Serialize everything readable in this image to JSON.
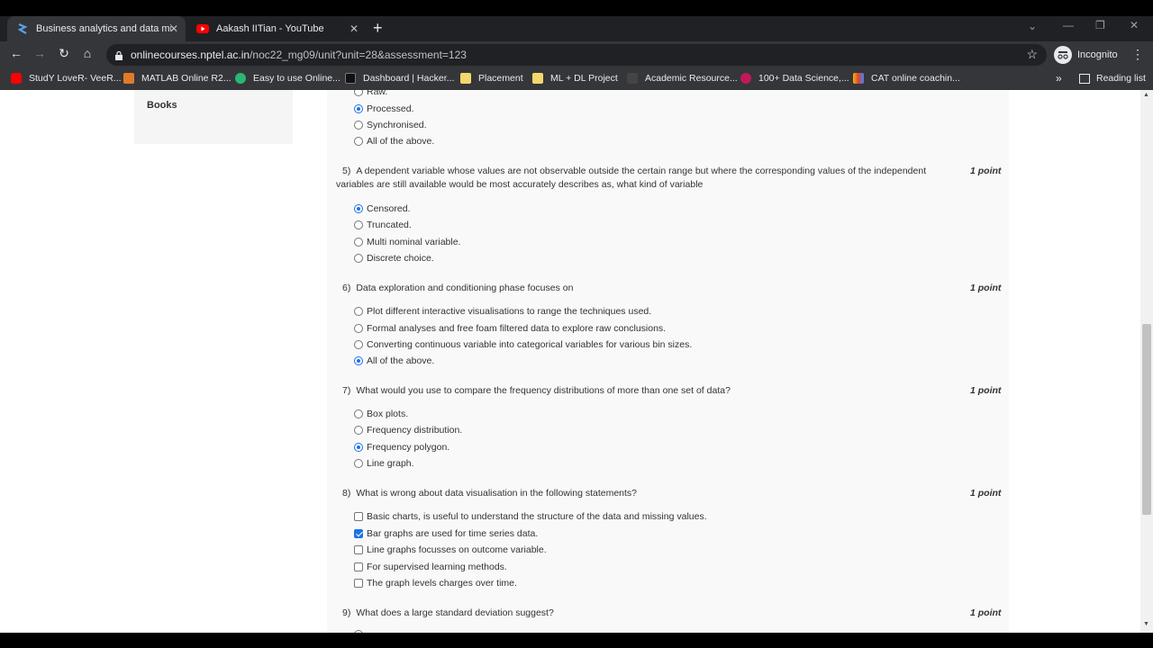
{
  "browser": {
    "tabs": [
      {
        "title": "Business analytics and data minin",
        "active": true
      },
      {
        "title": "Aakash IITian - YouTube",
        "active": false
      }
    ],
    "new_tab": "+",
    "url_host": "onlinecourses.nptel.ac.in",
    "url_path": "/noc22_mg09/unit?unit=28&assessment=123",
    "profile_label": "Incognito",
    "bookmarks": [
      "StudY LoveR- VeeR...",
      "MATLAB Online R2...",
      "Easy to use Online...",
      "Dashboard | Hacker...",
      "Placement",
      "ML + DL Project",
      "Academic Resource...",
      "100+ Data Science,...",
      "CAT online coachin..."
    ],
    "bookmarks_overflow": "»",
    "reading_list": "Reading list"
  },
  "sidebar": {
    "books_label": "Books"
  },
  "quiz": {
    "prev_options": [
      {
        "label": "Raw.",
        "checked": false
      },
      {
        "label": "Processed.",
        "checked": true
      },
      {
        "label": "Synchronised.",
        "checked": false
      },
      {
        "label": "All of the above.",
        "checked": false
      }
    ],
    "questions": [
      {
        "number": "5)",
        "text": "A dependent variable whose values are not observable outside the certain range but where the corresponding values of the independent variables are still available would be most accurately describes as, what kind of variable",
        "points": "1 point",
        "type": "radio",
        "options": [
          {
            "label": "Censored.",
            "checked": true
          },
          {
            "label": "Truncated.",
            "checked": false
          },
          {
            "label": "Multi nominal variable.",
            "checked": false
          },
          {
            "label": "Discrete choice.",
            "checked": false
          }
        ]
      },
      {
        "number": "6)",
        "text": "Data exploration and conditioning phase focuses on",
        "points": "1 point",
        "type": "radio",
        "options": [
          {
            "label": "Plot different interactive visualisations to range the techniques used.",
            "checked": false
          },
          {
            "label": "Formal analyses and free foam filtered data to explore raw conclusions.",
            "checked": false
          },
          {
            "label": "Converting continuous variable into categorical variables for various bin sizes.",
            "checked": false
          },
          {
            "label": "All of the above.",
            "checked": true
          }
        ]
      },
      {
        "number": "7)",
        "text": "What would you use to compare the frequency distributions of more than one set of data?",
        "points": "1 point",
        "type": "radio",
        "options": [
          {
            "label": "Box plots.",
            "checked": false
          },
          {
            "label": "Frequency distribution.",
            "checked": false
          },
          {
            "label": "Frequency polygon.",
            "checked": true
          },
          {
            "label": "Line graph.",
            "checked": false
          }
        ]
      },
      {
        "number": "8)",
        "text": "What is wrong about data visualisation in the following statements?",
        "points": "1 point",
        "type": "checkbox",
        "options": [
          {
            "label": "Basic charts, is useful to understand the structure of the data and missing values.",
            "checked": false
          },
          {
            "label": "Bar graphs are used for time series data.",
            "checked": true
          },
          {
            "label": "Line graphs focusses on outcome variable.",
            "checked": false
          },
          {
            "label": "For supervised learning methods.",
            "checked": false
          },
          {
            "label": "The graph levels charges over time.",
            "checked": false
          }
        ]
      },
      {
        "number": "9)",
        "text": "What does a large standard deviation suggest?",
        "points": "1 point",
        "type": "radio",
        "options": []
      }
    ]
  },
  "colors": {
    "accent": "#1a73e8",
    "chrome_dark": "#202124",
    "chrome_toolbar": "#35363a",
    "page_bg": "#ffffff",
    "content_bg": "#f9f9f9",
    "youtube_red": "#ff0000"
  }
}
